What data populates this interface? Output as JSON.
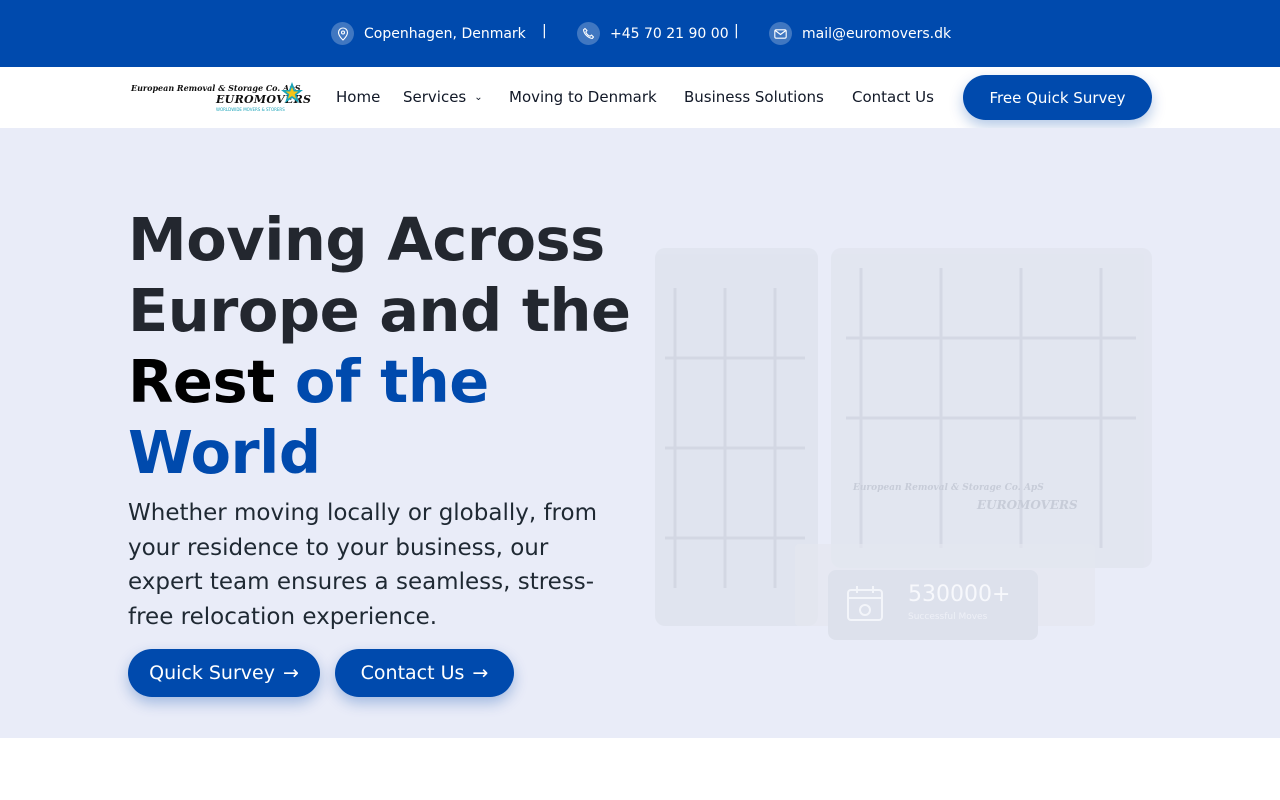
{
  "topbar": {
    "location": "Copenhagen, Denmark",
    "phone": "+45 70 21 90 00",
    "email": "mail@euromovers.dk",
    "separator": "|"
  },
  "logo": {
    "company": "European Removal & Storage Co. ApS",
    "brand": "EUROMOVERS",
    "tagline": "WORLDWIDE MOVERS & STORERS"
  },
  "nav": {
    "items": [
      "Home",
      "Services",
      "Moving to Denmark",
      "Business Solutions",
      "Contact Us"
    ],
    "cta": "Free Quick Survey"
  },
  "hero": {
    "title_line1": "Moving Across",
    "title_line2": "Europe and the",
    "title_rest": "Rest",
    "title_accent1": "of the",
    "title_accent2": "World",
    "subtitle": "Whether moving locally or globally, from your residence to your business, our expert team ensures a seamless, stress-free relocation experience.",
    "btn_survey": "Quick Survey",
    "btn_contact": "Contact Us",
    "arrow": "→"
  },
  "stat": {
    "value": "530000+",
    "label": "Successful Moves"
  },
  "colors": {
    "primary": "#004aad",
    "hero_bg": "#e9ecf8",
    "text_dark": "#23272f"
  },
  "icons": [
    "location-pin-icon",
    "phone-icon",
    "mail-icon",
    "chevron-down-icon",
    "arrow-right-icon",
    "calendar-icon"
  ]
}
